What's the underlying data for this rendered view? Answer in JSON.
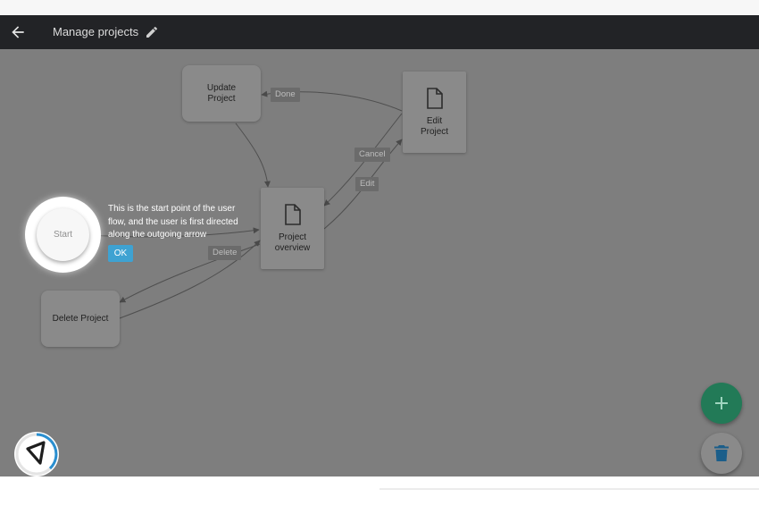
{
  "appbar": {
    "title": "Manage projects"
  },
  "nodes": {
    "update_project": "Update\nProject",
    "edit_project": "Edit\nProject",
    "project_overview": "Project\noverview",
    "delete_project": "Delete Project",
    "start": "Start"
  },
  "edge_labels": {
    "done": "Done",
    "cancel": "Cancel",
    "edit": "Edit",
    "delete": "Delete"
  },
  "tooltip": {
    "text": "This is the start point of the user flow, and the user is first directed along the outgoing arrow",
    "ok": "OK"
  },
  "icons": {
    "back": "arrow-back-icon",
    "edit_title": "pencil-icon",
    "document": "document-icon",
    "add": "plus-icon",
    "delete": "trash-icon",
    "logo": "brand-logo-icon"
  },
  "colors": {
    "appbar": "#222326",
    "overlay": "#7e7e7e",
    "ok_button": "#3ea2d2",
    "fab_add": "#227a57",
    "trash": "#1b5e8a",
    "logo_ring": "#2a8fd0"
  }
}
